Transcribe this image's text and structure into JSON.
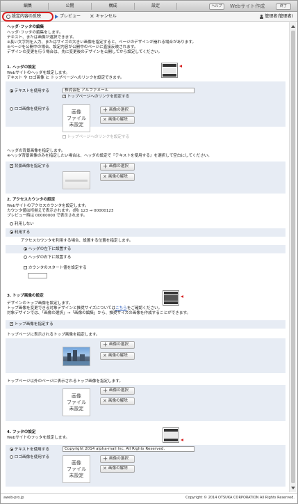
{
  "menu": {
    "items": [
      "編集",
      "公開",
      "構成",
      "設定"
    ],
    "help": "ヘルプ",
    "webmake": "Webサイト作成",
    "end": "終了"
  },
  "actions": {
    "reflect": "設定内容の反映",
    "preview": "プレビュー",
    "cancel": "キャンセル",
    "admin": "管理者(管理者)"
  },
  "page": {
    "title": "ヘッダ･フッタの編集",
    "intro": [
      "ヘッダ･フッタの編集をします。",
      "テキスト、または画像が選択できます。",
      "※長い文字列を入力、またはサイズの大きい画像を指定すると、ページのデザインが崩れる場合があります。",
      "※ページを公開中の場合、設定内容が公開中のページに直接反映されます。",
      "デザインの変更を行う場合は、先に変更後のデザインを公開してから設定してください。"
    ]
  },
  "header": {
    "title": "1. ヘッダの設定",
    "desc": [
      "Webサイトのヘッダを設定します。",
      "テキスト や ロゴ画像 に トップページへのリンクを設定できます。"
    ],
    "text_radio": "テキストを使用する",
    "text_value": "株式会社 アルファメール",
    "text_link": "トップページへのリンクを設定する",
    "logo_radio": "ロゴ画像を使用する",
    "noimg": "画像\nファイル\n未設定",
    "select": "画像の選択",
    "remove": "画像の解除",
    "logo_link": "トップページへのリンクを設定する",
    "bg_desc": [
      "ヘッダの背景画像を指定します。",
      "※ヘッダ背景画像のみを指定したい場合は、ヘッダの設定で『テキストを使用する』を選択して空白にしてください。"
    ],
    "bg_check": "背景画像を指定する"
  },
  "counter": {
    "title": "2. アクセスカウンタの設定",
    "desc": [
      "Webサイトのアクセスカウンタを設定します。",
      "カウンタ値は桁揃えで表示されます。(例) 123 → 00000123",
      "プレビュー時は 00000000 で表示されます。"
    ],
    "off": "利用しない",
    "on": "利用する",
    "pos_desc": "アクセスカウンタを利用する場合、設置する位置を指定します。",
    "pos_left": "ヘッダの左下に設置する",
    "pos_right": "ヘッダの右下に設置する",
    "start": "カウンタのスタート値を設定する"
  },
  "top": {
    "title": "3. トップ画像の設定",
    "desc1": "デザインのトップ画像を設定します。",
    "desc2_a": "トップ画像を変更できる対象デザインと推奨サイズについては",
    "desc2_link": "こちら",
    "desc2_b": "をご確認ください。",
    "desc3": "対象デザインでは、「画像の選択」→「画像の編集」から、推奨サイズの画像を作成することができます。",
    "check": "トップ画像を指定する",
    "top_desc": "トップページに表示されるトップ画像を指定します。",
    "other_desc": "トップページ以外のページに表示されるトップ画像を指定します。",
    "select": "画像の選択",
    "remove": "画像の解除",
    "noimg": "画像\nファイル\n未設定"
  },
  "footer_cfg": {
    "title": "4. フッタの設定",
    "desc": "Webサイトのフッタを設定します。",
    "text_radio": "テキストを使用する",
    "text_value": "Copyright 2014 alpha-mail Inc. All Rights Reserved.",
    "logo_radio": "ロゴ画像を使用する",
    "noimg": "画像\nファイル\n未設定",
    "select": "画像の選択",
    "remove": "画像の解除"
  },
  "footer": {
    "left": "aweb-pro.jp",
    "right": "Copyright © 2014 OTSUKA CORPORATION All Rights Reserved."
  },
  "colors": {
    "accent_red": "#d82020",
    "band": "#e7ecf4"
  },
  "icons": [
    "circle-icon",
    "play-icon",
    "close-icon",
    "person-icon",
    "plus-icon",
    "x-icon",
    "layout-icon",
    "red-arrow-icon"
  ]
}
